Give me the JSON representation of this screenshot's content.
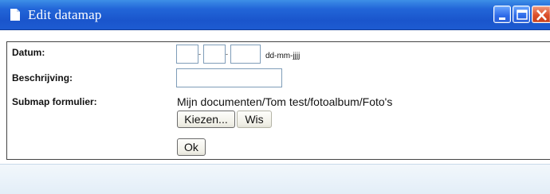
{
  "window": {
    "title": "Edit datamap",
    "colors": {
      "titlebar": "#2266d8",
      "close_button": "#dc4f2a",
      "footer": "#e3eef8"
    }
  },
  "form": {
    "datum_label": "Datum:",
    "date_separator": "-",
    "date_format_hint": "dd-mm-jjjj",
    "beschrijving_label": "Beschrijving:",
    "submap_label": "Submap formulier:",
    "submap_path": "Mijn documenten/Tom test/fotoalbum/Foto's",
    "kiezen_label": "Kiezen...",
    "wis_label": "Wis",
    "ok_label": "Ok"
  },
  "icons": [
    "document-icon",
    "minimize-icon",
    "maximize-icon",
    "close-icon"
  ]
}
